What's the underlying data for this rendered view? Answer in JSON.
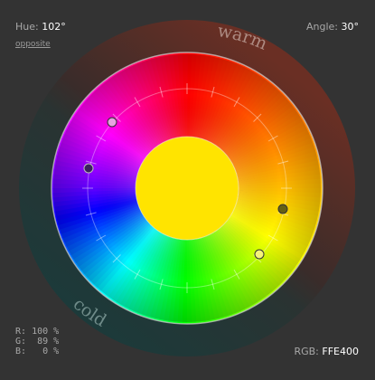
{
  "header": {
    "hue_label": "Hue:",
    "hue_value": "102°",
    "opposite_link": "opposite",
    "angle_label": "Angle:",
    "angle_value": "30°"
  },
  "wheel": {
    "warm_label": "warm",
    "cold_label": "cold",
    "center_color": "#FFE400",
    "markers": [
      {
        "name": "marker-pink",
        "color": "#e7a0e0"
      },
      {
        "name": "marker-purple",
        "color": "#3b1f5e"
      },
      {
        "name": "marker-olive",
        "color": "#656014"
      },
      {
        "name": "marker-lightyellow",
        "color": "#f4f37a"
      }
    ]
  },
  "footer": {
    "r_label": "R:",
    "r_value": "100 %",
    "g_label": "G:",
    "g_value": " 89 %",
    "b_label": "B:",
    "b_value": "  0 %",
    "rgb_label": "RGB:",
    "rgb_value": "FFE400"
  },
  "colors": {
    "background": "#333333",
    "warm_ring": "#5a2b22",
    "cold_ring": "#1f3535"
  }
}
